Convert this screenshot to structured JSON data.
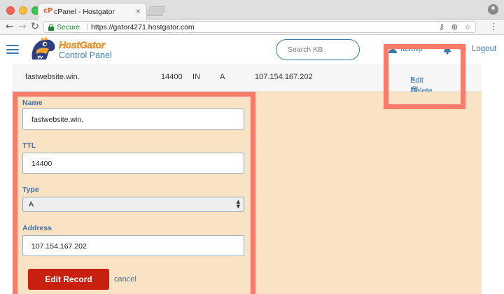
{
  "browser": {
    "tab_title": "cPanel - Hostgator",
    "tab_icon": "cpanel-logo-icon",
    "secure_label": "Secure",
    "url": "https://gator4271.hostgator.com"
  },
  "header": {
    "brand_name": "HostGator",
    "brand_subtitle": "Control Panel",
    "search_placeholder": "Search KB",
    "username": "fastwp",
    "logout_label": "Logout",
    "brand_color": "#f4a22d",
    "accent_color": "#3a79a8"
  },
  "record": {
    "name": "fastwebsite.win.",
    "ttl": "14400",
    "class": "IN",
    "type": "A",
    "address": "107.154.167.202",
    "actions": {
      "edit_label": "Edit",
      "edit_icon": "pencil-icon",
      "delete_label": "Delete",
      "delete_icon": "trash-icon"
    }
  },
  "edit_form": {
    "name_label": "Name",
    "name_value": "fastwebsite.win.",
    "ttl_label": "TTL",
    "ttl_value": "14400",
    "type_label": "Type",
    "type_value": "A",
    "address_label": "Address",
    "address_value": "107.154.167.202",
    "submit_label": "Edit Record",
    "cancel_label": "cancel",
    "panel_color": "#fae3c5",
    "button_color": "#c8200e"
  },
  "annotations": {
    "highlight_color": "#fb7b6b"
  }
}
